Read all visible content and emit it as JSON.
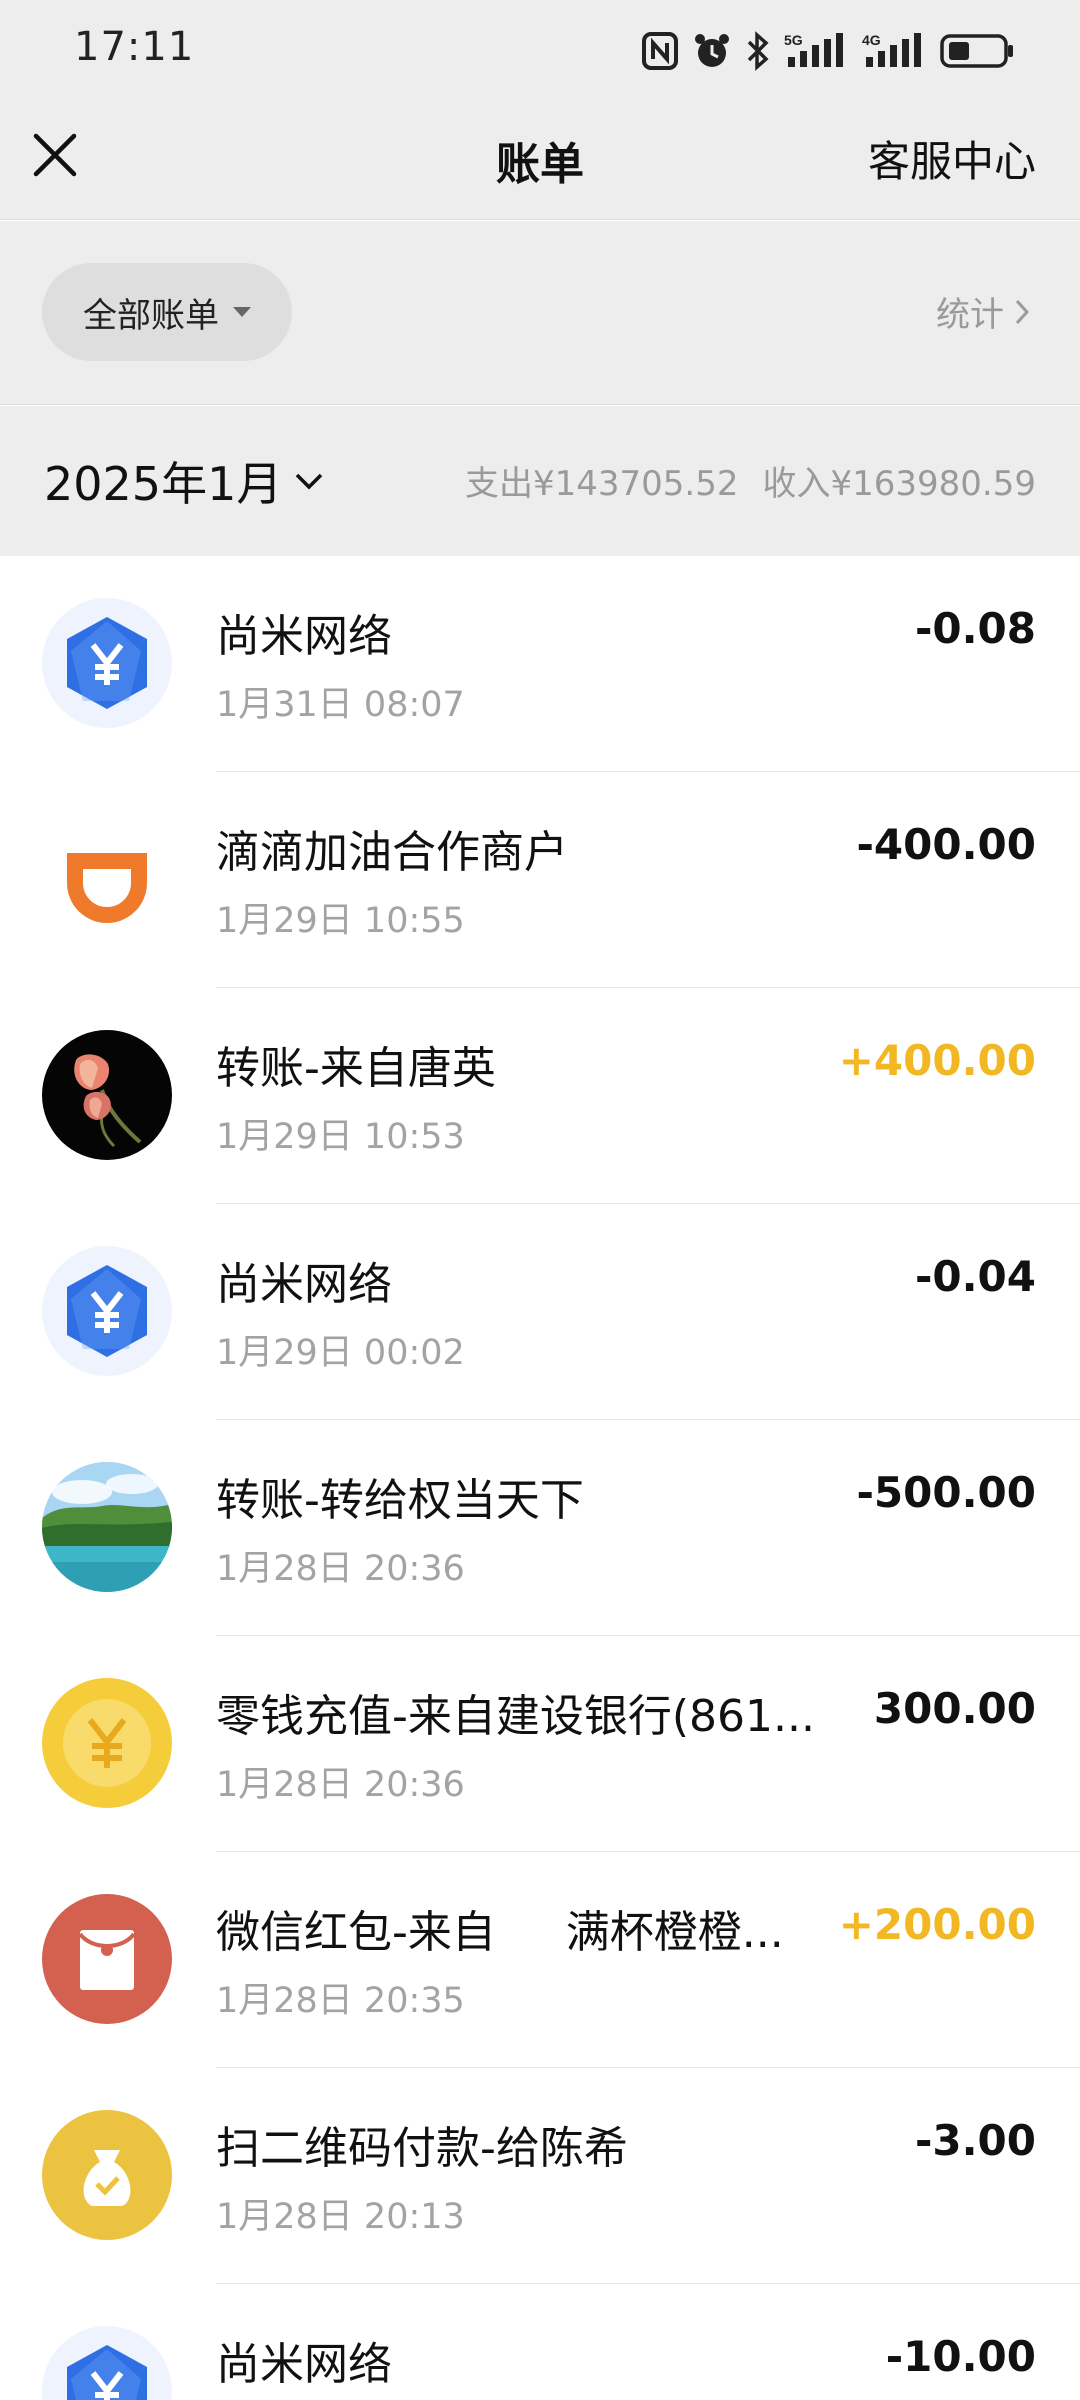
{
  "status_bar": {
    "time": "17:11",
    "icons": [
      "nfc-icon",
      "alarm-icon",
      "bluetooth-icon",
      "signal-5g-icon",
      "signal-4g-icon",
      "battery-icon"
    ],
    "network_labels": [
      "5G",
      "4G"
    ]
  },
  "header": {
    "title": "账单",
    "service_label": "客服中心"
  },
  "filter": {
    "all_bills_label": "全部账单",
    "stats_label": "统计"
  },
  "month": {
    "label": "2025年1月",
    "expense": "支出¥143705.52",
    "income": "收入¥163980.59"
  },
  "colors": {
    "income_amount": "#f2b823",
    "background_gray": "#ededed",
    "hex_icon_blue": "#2f6fe4",
    "didi_orange": "#ef7a2c",
    "coin_yellow": "#f5cc3a",
    "red_packet": "#d4604f"
  },
  "transactions": [
    {
      "title": "尚米网络",
      "time": "1月31日 08:07",
      "amount": "-0.08",
      "icon": "yuan-hexagon-icon"
    },
    {
      "title": "滴滴加油合作商户",
      "time": "1月29日 10:55",
      "amount": "-400.00",
      "icon": "didi-logo-icon"
    },
    {
      "title": "转账-来自唐英",
      "time": "1月29日 10:53",
      "amount": "+400.00",
      "icon": "flower-avatar"
    },
    {
      "title": "尚米网络",
      "time": "1月29日 00:02",
      "amount": "-0.04",
      "icon": "yuan-hexagon-icon"
    },
    {
      "title": "转账-转给权当天下",
      "time": "1月28日 20:36",
      "amount": "-500.00",
      "icon": "landscape-avatar"
    },
    {
      "title": "零钱充值-来自建设银行(861...",
      "time": "1月28日 20:36",
      "amount": "300.00",
      "icon": "yuan-coin-icon"
    },
    {
      "title": "微信红包-来自     满杯橙橙...",
      "time": "1月28日 20:35",
      "amount": "+200.00",
      "icon": "red-packet-icon"
    },
    {
      "title": "扫二维码付款-给陈希",
      "time": "1月28日 20:13",
      "amount": "-3.00",
      "icon": "money-bag-icon"
    },
    {
      "title": "尚米网络",
      "time": "",
      "amount": "-10.00",
      "icon": "yuan-hexagon-icon"
    }
  ]
}
